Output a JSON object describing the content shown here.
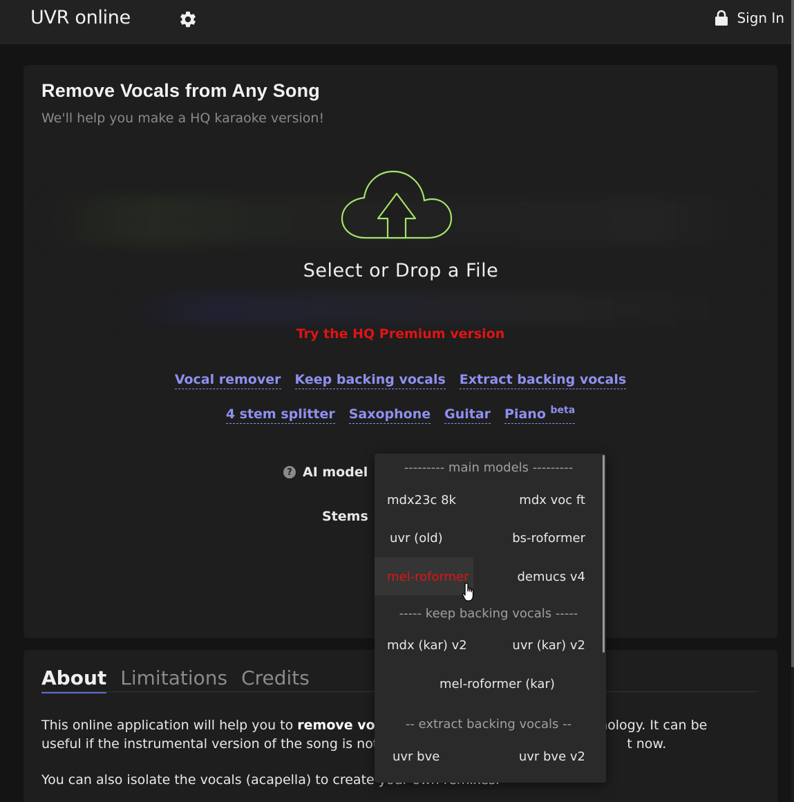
{
  "topbar": {
    "brand": "UVR online",
    "settings_icon": "gear-icon",
    "signin_icon": "lock-icon",
    "signin_label": "Sign In"
  },
  "main": {
    "title": "Remove Vocals from Any Song",
    "subtitle": "We'll help you make a HQ karaoke version!",
    "upload_icon": "cloud-upload-icon",
    "drop_label": "Select or Drop a File",
    "premium_link": "Try the HQ Premium version",
    "modes_row1": [
      "Vocal remover",
      "Keep backing vocals",
      "Extract backing vocals"
    ],
    "modes_row2": [
      "4 stem splitter",
      "Saxophone",
      "Guitar",
      "Piano"
    ],
    "piano_badge": "beta",
    "ai_model_label": "AI model",
    "stems_label": "Stems"
  },
  "dropdown": {
    "group_main": "--------- main models ---------",
    "group_keep": "----- keep backing vocals -----",
    "group_extract": "-- extract backing vocals --",
    "options": {
      "mdx23c": "mdx23c 8k",
      "mdx_voc_ft": "mdx voc ft",
      "uvr_old": "uvr (old)",
      "bs_roformer": "bs-roformer",
      "mel_roformer": "mel-roformer",
      "demucs": "demucs v4",
      "mdx_kar": "mdx (kar) v2",
      "uvr_kar": "uvr (kar) v2",
      "mel_kar": "mel-roformer (kar)",
      "uvr_bve": "uvr bve",
      "uvr_bve_v2": "uvr bve v2"
    },
    "selected": "mel-roformer",
    "selected_color": "#e01414"
  },
  "info": {
    "tabs": [
      "About",
      "Limitations",
      "Credits"
    ],
    "active_tab": "About",
    "p1_a": "This online application will help you to ",
    "p1_bold": "remove vocals",
    "p1_b": " ed technology. It can be",
    "p1_c": "useful if the instrumental version of the song is not ye",
    "p1_d": "t now.",
    "p2": "You can also isolate the vocals (acapella) to create your own remixes."
  },
  "colors": {
    "accent_link": "#8f90f0",
    "premium": "#e01414",
    "cloud_stroke": "#a6e36a"
  }
}
